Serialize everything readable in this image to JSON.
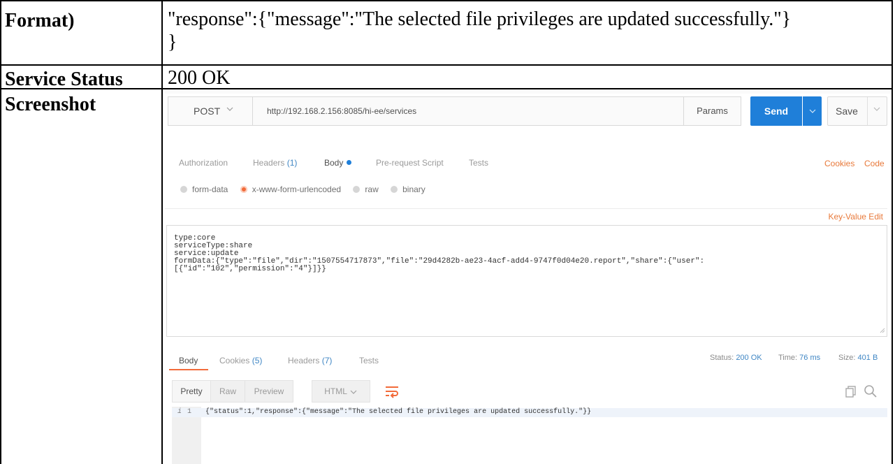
{
  "table": {
    "rows": [
      {
        "label": "Format)",
        "value": "\"response\":{\"message\":\"The selected file privileges are updated successfully.\"}",
        "value_cont": "}"
      },
      {
        "label": "Service Status",
        "value": "200 OK"
      },
      {
        "label": "Screenshot"
      }
    ]
  },
  "postman": {
    "method": "POST",
    "url": "http://192.168.2.156:8085/hi-ee/services",
    "params_label": "Params",
    "send_label": "Send",
    "save_label": "Save",
    "request_tabs": [
      {
        "label": "Authorization"
      },
      {
        "label": "Headers",
        "count": "(1)"
      },
      {
        "label": "Body",
        "active": true
      },
      {
        "label": "Pre-request Script"
      },
      {
        "label": "Tests"
      }
    ],
    "cookies_link": "Cookies",
    "code_link": "Code",
    "body_types": [
      "form-data",
      "x-www-form-urlencoded",
      "raw",
      "binary"
    ],
    "selected_body_type": "x-www-form-urlencoded",
    "key_value_edit": "Key-Value Edit",
    "body_text": "type:core\nserviceType:share\nservice:update\nformData:{\"type\":\"file\",\"dir\":\"1507554717873\",\"file\":\"29d4282b-ae23-4acf-add4-9747f0d04e20.report\",\"share\":{\"user\":\n[{\"id\":\"102\",\"permission\":\"4\"}]}}",
    "response_tabs": [
      {
        "label": "Body",
        "active": true
      },
      {
        "label": "Cookies",
        "count": "(5)"
      },
      {
        "label": "Headers",
        "count": "(7)"
      },
      {
        "label": "Tests"
      }
    ],
    "status_label": "Status:",
    "status_value": "200 OK",
    "time_label": "Time:",
    "time_value": "76 ms",
    "size_label": "Size:",
    "size_value": "401 B",
    "view_modes": [
      "Pretty",
      "Raw",
      "Preview"
    ],
    "format": "HTML",
    "line_marker": "i",
    "line_number": "1",
    "response_line": "{\"status\":1,\"response\":{\"message\":\"The selected file privileges are updated successfully.\"}}",
    "colors": {
      "accent": "#1f7fd9",
      "orange": "#e8793a",
      "count_blue": "#3f86c4"
    },
    "icons": [
      "chevron-down-icon",
      "wrap-lines-icon",
      "copy-icon",
      "search-icon",
      "radio-icon"
    ]
  }
}
